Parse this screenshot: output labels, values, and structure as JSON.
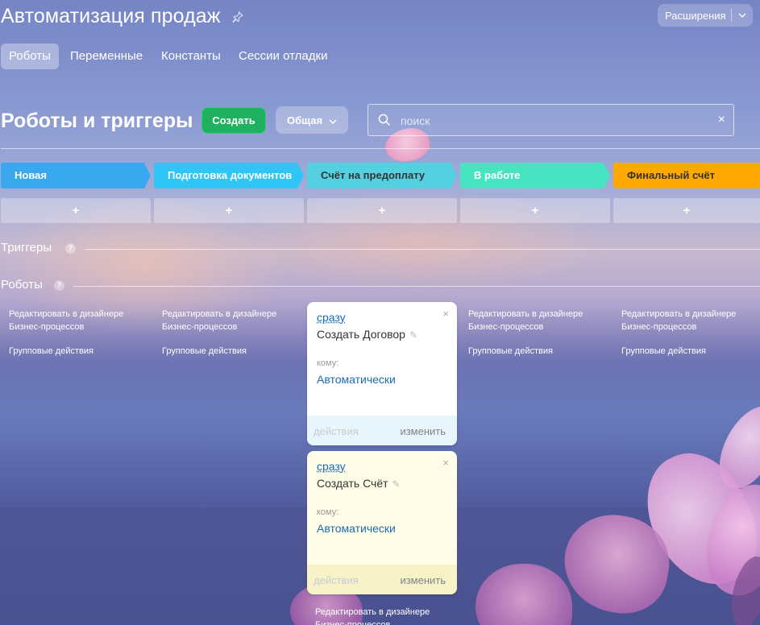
{
  "header": {
    "title": "Автоматизация продаж",
    "extensions_label": "Расширения"
  },
  "tabs": [
    {
      "label": "Роботы",
      "active": true
    },
    {
      "label": "Переменные",
      "active": false
    },
    {
      "label": "Константы",
      "active": false
    },
    {
      "label": "Сессии отладки",
      "active": false
    }
  ],
  "toolbar": {
    "section_title": "Роботы и триггеры",
    "create_label": "Создать",
    "common_label": "Общая",
    "search_placeholder": "поиск"
  },
  "stages": [
    {
      "label": "Новая",
      "color": "#39a8ef"
    },
    {
      "label": "Подготовка документов",
      "color": "#2fc6f6"
    },
    {
      "label": "Счёт на предоплату",
      "color": "#55d0e0"
    },
    {
      "label": "В работе",
      "color": "#47e4c2"
    },
    {
      "label": "Финальный счёт",
      "color": "#ffa900"
    }
  ],
  "add_symbol": "+",
  "triggers": {
    "title": "Триггеры",
    "help": "?"
  },
  "robots": {
    "title": "Роботы",
    "help": "?"
  },
  "column_links": {
    "designer": "Редактировать в дизайнере",
    "designer_2": "Бизнес-процессов",
    "group": "Групповые действия"
  },
  "robot_cards": [
    {
      "delay": "сразу",
      "name": "Создать Договор",
      "to_label": "кому:",
      "to_value": "Автоматически",
      "actions_label": "действия",
      "edit_label": "изменить",
      "theme": "white"
    },
    {
      "delay": "сразу",
      "name": "Создать Счёт",
      "to_label": "кому:",
      "to_value": "Автоматически",
      "actions_label": "действия",
      "edit_label": "изменить",
      "theme": "yellow"
    }
  ],
  "close_symbol": "×",
  "colors": {
    "create_button": "#1fb15f",
    "link_blue": "#1a6bb3"
  }
}
